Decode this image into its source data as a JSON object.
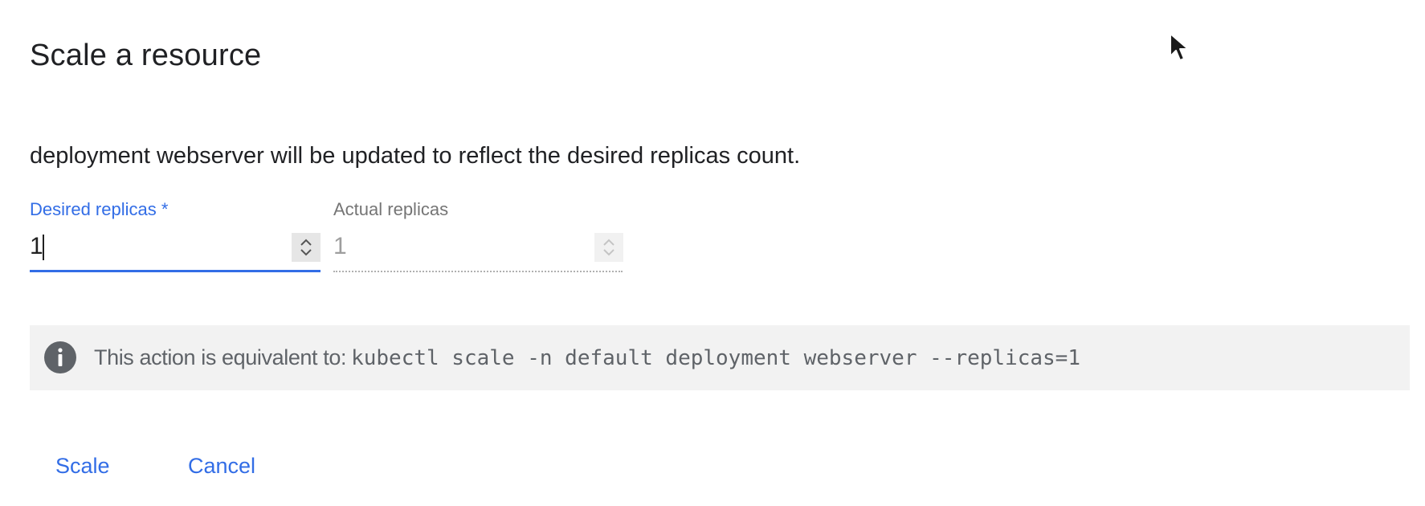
{
  "dialog": {
    "title": "Scale a resource",
    "description": "deployment webserver will be updated to reflect the desired replicas count."
  },
  "fields": {
    "desired": {
      "label": "Desired replicas *",
      "value": "1"
    },
    "actual": {
      "label": "Actual replicas",
      "value": "1"
    }
  },
  "info": {
    "icon": "info-icon",
    "prefix": "This action is equivalent to:",
    "command": "kubectl scale -n default deployment webserver --replicas=1"
  },
  "actions": {
    "scale_label": "Scale",
    "cancel_label": "Cancel"
  },
  "colors": {
    "accent": "#326de6",
    "info_background": "#f2f2f2",
    "info_icon": "#5f6368"
  }
}
